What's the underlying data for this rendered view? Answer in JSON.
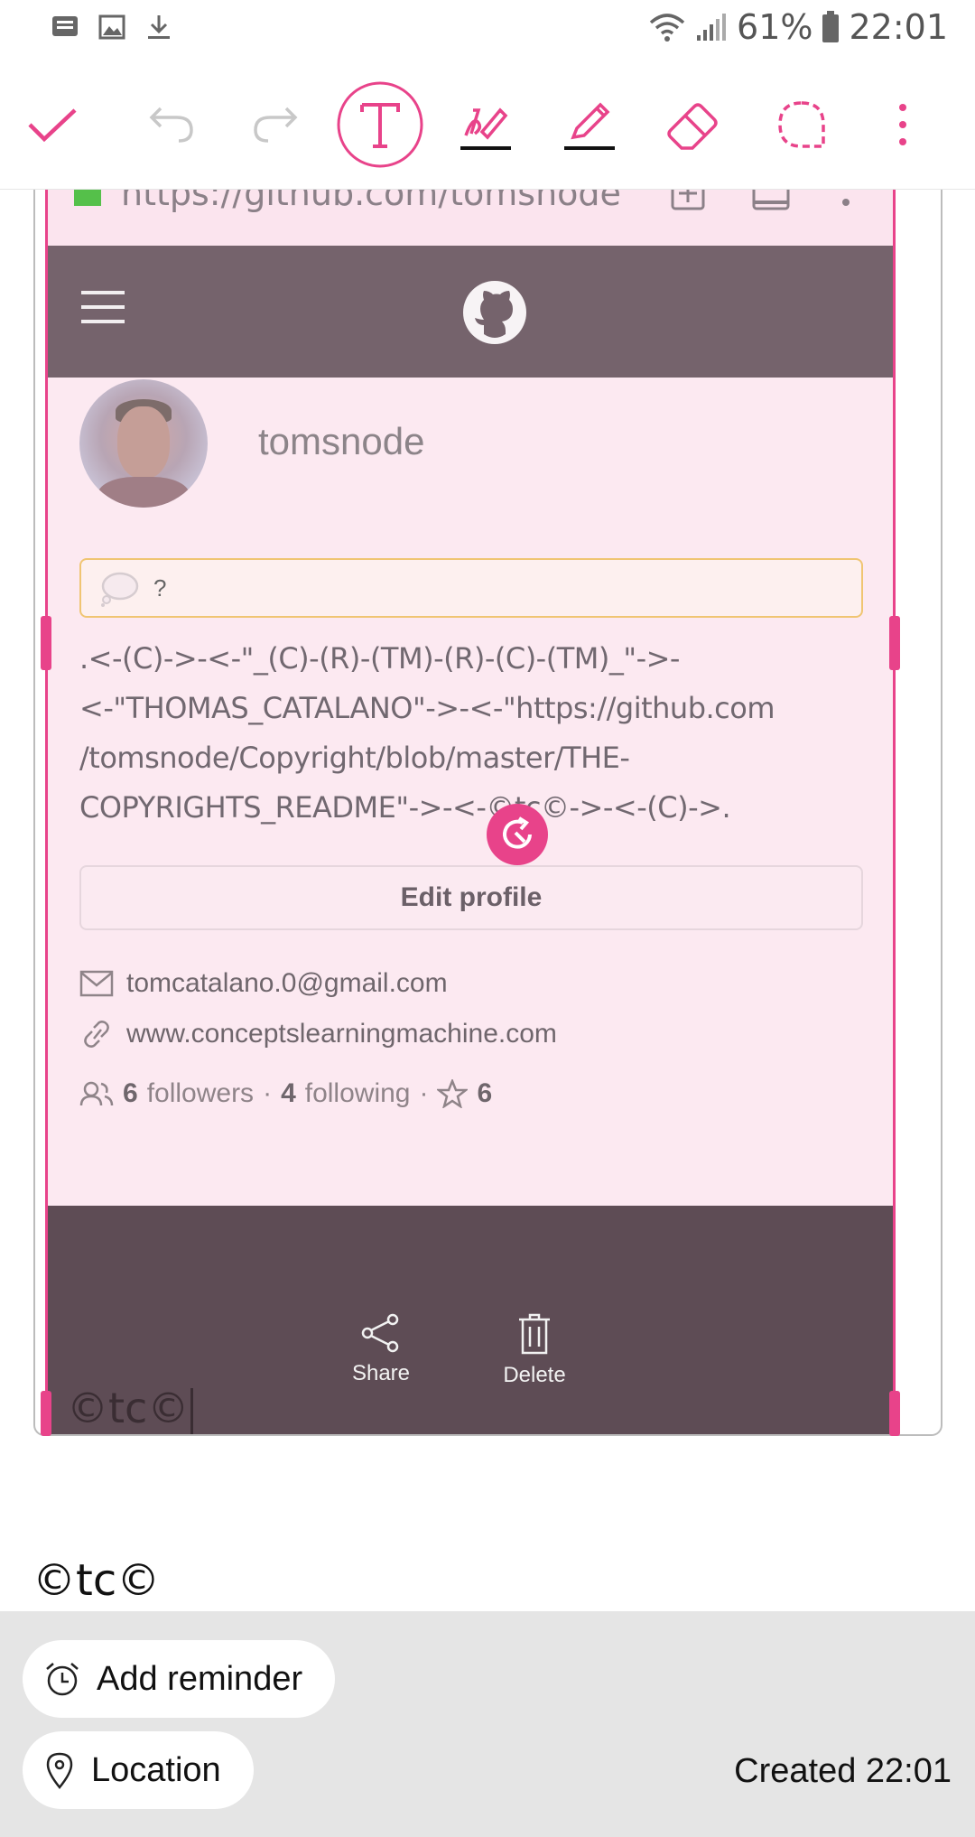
{
  "status_bar": {
    "battery": "61%",
    "time": "22:01"
  },
  "toolbar": {
    "items": [
      "check-icon",
      "undo-icon",
      "redo-icon",
      "text-mode-icon",
      "pen-style-icon",
      "pencil-icon",
      "eraser-icon",
      "lasso-icon",
      "more-icon"
    ],
    "accent": "#e8438a"
  },
  "screenshot": {
    "url": "https://github.com/tomsnode",
    "username": "tomsnode",
    "status_placeholder": "?",
    "bio": ".<-(C)->-<-\"_(C)-(R)-(TM)-(R)-(C)-(TM)_\"->-<-\"THOMAS_CATALANO\"->-<-\"https://github.com/tomsnode/Copyright/blob/master/THE-COPYRIGHTS_README\"->-<-©tc©->-<-(C)->.",
    "bio_lines": [
      ".<-(C)->-<-\"_(C)-(R)-(TM)-(R)-(C)-(TM)_\"->-",
      "<-\"THOMAS_CATALANO\"->-<-\"https://github.com",
      "/tomsnode/Copyright/blob/master/THE-",
      "COPYRIGHTS_README\"->-<-©tc©->-<-(C)->."
    ],
    "edit_profile": "Edit profile",
    "email": "tomcatalano.0@gmail.com",
    "website": "www.conceptslearningmachine.com",
    "followers_count": "6",
    "followers_label": "followers",
    "following_count": "4",
    "following_label": "following",
    "stars_count": "6",
    "share_label": "Share",
    "delete_label": "Delete",
    "handwritten": "©tc©"
  },
  "note_text": "©tc©",
  "bottom": {
    "add_reminder": "Add reminder",
    "location": "Location",
    "created": "Created 22:01"
  }
}
